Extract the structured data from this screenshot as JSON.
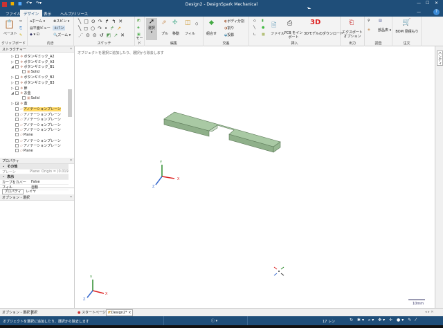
{
  "window": {
    "title": "Design2 - DesignSpark Mechanical"
  },
  "tabs": [
    {
      "label": "ファイル"
    },
    {
      "label": "デザイン",
      "active": true
    },
    {
      "label": "表示"
    },
    {
      "label": "ヘルプ/リソース"
    }
  ],
  "ribbon": {
    "clipboard": {
      "label": "クリップボード",
      "paste": "ペースト"
    },
    "orient": {
      "label": "向き",
      "home": "ホーム",
      "plane_view": "平面ビュー",
      "spin": "スピン",
      "pan": "パン",
      "zoom": "ズーム"
    },
    "sketch": {
      "label": "スケッチ"
    },
    "mode": {
      "label": "モード"
    },
    "edit": {
      "label": "編集",
      "select": "選択",
      "pull": "プル",
      "move": "移動",
      "fill": "フィル"
    },
    "intersect": {
      "label": "交差",
      "combine": "組合せ",
      "split_body": "ボディ分割",
      "split": "割り",
      "project": "投影"
    },
    "insert": {
      "label": "挿入",
      "file": "ファイル",
      "pcb": "PCB をインポート",
      "download": "3Dモデルのダウンロード"
    },
    "output": {
      "label": "出力",
      "export": "エクスポートオプション"
    },
    "investigate": {
      "label": "調査",
      "parts": "部品表"
    },
    "order": {
      "label": "注文",
      "bom": "BOM 見積もり"
    }
  },
  "structure": {
    "title": "ストラクチャー",
    "items": [
      {
        "label": "ボタンギミック_A2",
        "indent": 1,
        "expander": "▷"
      },
      {
        "label": "ボタンギミック_A3",
        "indent": 1,
        "expander": "▷"
      },
      {
        "label": "ボタンギミック_B1",
        "indent": 1,
        "expander": "◢"
      },
      {
        "label": "Solid",
        "indent": 2,
        "expander": ""
      },
      {
        "label": "ボタンギミック_B2",
        "indent": 1,
        "expander": "▷"
      },
      {
        "label": "ボタンギミック_B3",
        "indent": 1,
        "expander": "▷"
      },
      {
        "label": "節",
        "indent": 1,
        "expander": "▷"
      },
      {
        "label": "お金",
        "indent": 1,
        "expander": "◢"
      },
      {
        "label": "Solid",
        "indent": 2,
        "expander": ""
      },
      {
        "label": "蓋",
        "indent": 1,
        "expander": "▷",
        "checked": true
      },
      {
        "label": "アノテーションプレーン",
        "indent": 1,
        "expander": "",
        "selected": true
      },
      {
        "label": "アノテーションプレーン",
        "indent": 1,
        "expander": ""
      },
      {
        "label": "アノテーションプレーン",
        "indent": 1,
        "expander": ""
      },
      {
        "label": "アノテーションプレーン",
        "indent": 1,
        "expander": ""
      },
      {
        "label": "アノテーションプレーン",
        "indent": 1,
        "expander": ""
      },
      {
        "label": "Plane",
        "indent": 1,
        "expander": ""
      },
      {
        "label": "アノテーションプレーン",
        "indent": 1,
        "expander": ""
      },
      {
        "label": "アノテーションプレーン",
        "indent": 1,
        "expander": ""
      },
      {
        "label": "Plane",
        "indent": 1,
        "expander": ""
      }
    ]
  },
  "properties": {
    "title": "プロパティ",
    "sections": [
      {
        "header": "その他",
        "rows": [
          {
            "name": "プレーン",
            "value": "Plane: Origin = (0.0192"
          }
        ]
      },
      {
        "header": "表示",
        "rows": [
          {
            "name": "カーブをカバー",
            "value": "False"
          },
          {
            "name": "フィル",
            "value": "自動"
          }
        ]
      }
    ],
    "tabs": [
      "プロパティ",
      "レイヤ"
    ]
  },
  "options": {
    "title": "オプション - 選択"
  },
  "bottom_left_tabs": [
    "オプション - 選択",
    "選択"
  ],
  "viewport": {
    "hint": "オブジェクトを選択に追加したり、選択から除去します",
    "scale": "10mm",
    "body_color": "#a9c9a4"
  },
  "doc_tabs": [
    {
      "label": "スタートページ"
    },
    {
      "label": "Design2*",
      "active": true
    }
  ],
  "right_strip": {
    "label": "ハンディ"
  },
  "status": {
    "message": "オブジェクトを選択に追加したり、選択から除去します",
    "info": "ⓘ ▾",
    "count": "17 レン"
  }
}
